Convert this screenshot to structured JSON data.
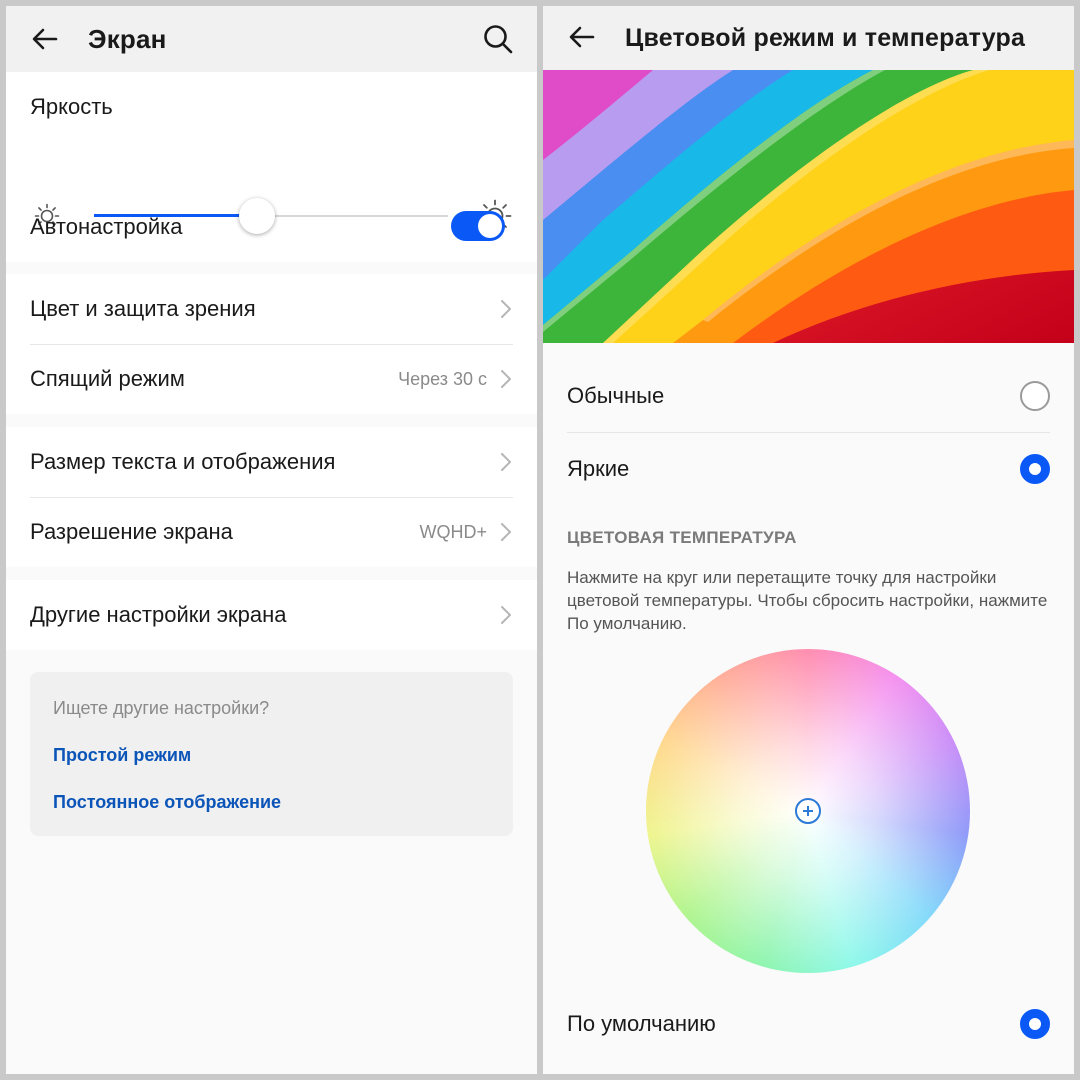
{
  "left": {
    "title": "Экран",
    "brightness": {
      "label": "Яркость",
      "level": 0.46,
      "auto_label": "Автонастройка",
      "auto_on": true
    },
    "groups": [
      {
        "rows": [
          {
            "label": "Цвет и защита зрения",
            "value": ""
          },
          {
            "label": "Спящий режим",
            "value": "Через 30 с"
          }
        ]
      },
      {
        "rows": [
          {
            "label": "Размер текста и отображения",
            "value": ""
          },
          {
            "label": "Разрешение экрана",
            "value": "WQHD+"
          }
        ]
      },
      {
        "rows": [
          {
            "label": "Другие настройки экрана",
            "value": ""
          }
        ]
      }
    ],
    "suggest": {
      "question": "Ищете другие настройки?",
      "links": [
        "Простой режим",
        "Постоянное отображение"
      ]
    }
  },
  "right": {
    "title": "Цветовой режим и температура",
    "modes": [
      {
        "label": "Обычные",
        "selected": false
      },
      {
        "label": "Яркие",
        "selected": true
      }
    ],
    "temperature": {
      "section_title": "ЦВЕТОВАЯ ТЕМПЕРАТУРА",
      "hint": "Нажмите на круг или перетащите точку для настройки цветовой температуры. Чтобы сбросить настройки, нажмите По умолчанию.",
      "default_label": "По умолчанию",
      "default_selected": true
    }
  },
  "colors": {
    "accent": "#0a59f7",
    "link": "#0b54b8",
    "background": "#fafafa",
    "topbar": "#f1f1f1"
  }
}
